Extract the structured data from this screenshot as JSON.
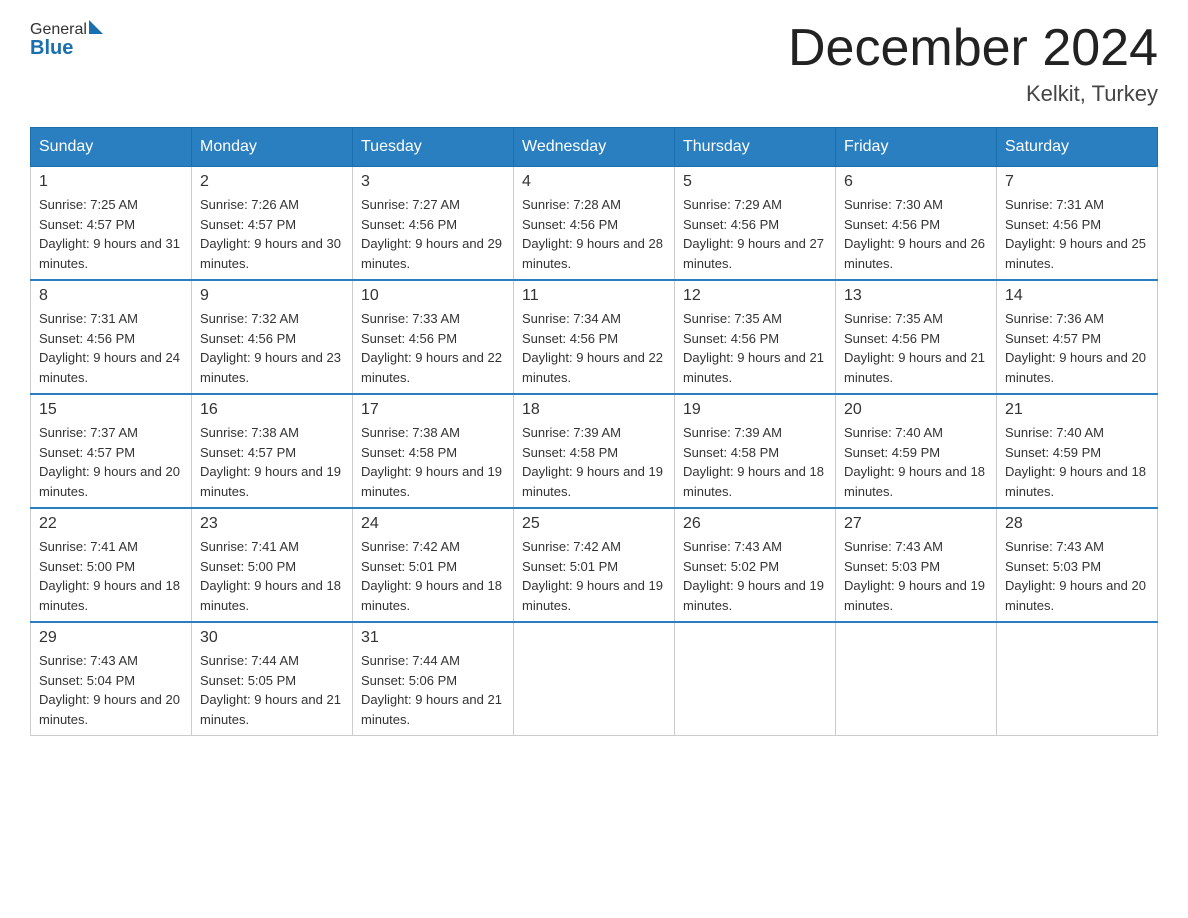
{
  "logo": {
    "general": "General",
    "blue": "Blue"
  },
  "title": "December 2024",
  "location": "Kelkit, Turkey",
  "days_of_week": [
    "Sunday",
    "Monday",
    "Tuesday",
    "Wednesday",
    "Thursday",
    "Friday",
    "Saturday"
  ],
  "weeks": [
    [
      {
        "num": "1",
        "sunrise": "7:25 AM",
        "sunset": "4:57 PM",
        "daylight": "9 hours and 31 minutes."
      },
      {
        "num": "2",
        "sunrise": "7:26 AM",
        "sunset": "4:57 PM",
        "daylight": "9 hours and 30 minutes."
      },
      {
        "num": "3",
        "sunrise": "7:27 AM",
        "sunset": "4:56 PM",
        "daylight": "9 hours and 29 minutes."
      },
      {
        "num": "4",
        "sunrise": "7:28 AM",
        "sunset": "4:56 PM",
        "daylight": "9 hours and 28 minutes."
      },
      {
        "num": "5",
        "sunrise": "7:29 AM",
        "sunset": "4:56 PM",
        "daylight": "9 hours and 27 minutes."
      },
      {
        "num": "6",
        "sunrise": "7:30 AM",
        "sunset": "4:56 PM",
        "daylight": "9 hours and 26 minutes."
      },
      {
        "num": "7",
        "sunrise": "7:31 AM",
        "sunset": "4:56 PM",
        "daylight": "9 hours and 25 minutes."
      }
    ],
    [
      {
        "num": "8",
        "sunrise": "7:31 AM",
        "sunset": "4:56 PM",
        "daylight": "9 hours and 24 minutes."
      },
      {
        "num": "9",
        "sunrise": "7:32 AM",
        "sunset": "4:56 PM",
        "daylight": "9 hours and 23 minutes."
      },
      {
        "num": "10",
        "sunrise": "7:33 AM",
        "sunset": "4:56 PM",
        "daylight": "9 hours and 22 minutes."
      },
      {
        "num": "11",
        "sunrise": "7:34 AM",
        "sunset": "4:56 PM",
        "daylight": "9 hours and 22 minutes."
      },
      {
        "num": "12",
        "sunrise": "7:35 AM",
        "sunset": "4:56 PM",
        "daylight": "9 hours and 21 minutes."
      },
      {
        "num": "13",
        "sunrise": "7:35 AM",
        "sunset": "4:56 PM",
        "daylight": "9 hours and 21 minutes."
      },
      {
        "num": "14",
        "sunrise": "7:36 AM",
        "sunset": "4:57 PM",
        "daylight": "9 hours and 20 minutes."
      }
    ],
    [
      {
        "num": "15",
        "sunrise": "7:37 AM",
        "sunset": "4:57 PM",
        "daylight": "9 hours and 20 minutes."
      },
      {
        "num": "16",
        "sunrise": "7:38 AM",
        "sunset": "4:57 PM",
        "daylight": "9 hours and 19 minutes."
      },
      {
        "num": "17",
        "sunrise": "7:38 AM",
        "sunset": "4:58 PM",
        "daylight": "9 hours and 19 minutes."
      },
      {
        "num": "18",
        "sunrise": "7:39 AM",
        "sunset": "4:58 PM",
        "daylight": "9 hours and 19 minutes."
      },
      {
        "num": "19",
        "sunrise": "7:39 AM",
        "sunset": "4:58 PM",
        "daylight": "9 hours and 18 minutes."
      },
      {
        "num": "20",
        "sunrise": "7:40 AM",
        "sunset": "4:59 PM",
        "daylight": "9 hours and 18 minutes."
      },
      {
        "num": "21",
        "sunrise": "7:40 AM",
        "sunset": "4:59 PM",
        "daylight": "9 hours and 18 minutes."
      }
    ],
    [
      {
        "num": "22",
        "sunrise": "7:41 AM",
        "sunset": "5:00 PM",
        "daylight": "9 hours and 18 minutes."
      },
      {
        "num": "23",
        "sunrise": "7:41 AM",
        "sunset": "5:00 PM",
        "daylight": "9 hours and 18 minutes."
      },
      {
        "num": "24",
        "sunrise": "7:42 AM",
        "sunset": "5:01 PM",
        "daylight": "9 hours and 18 minutes."
      },
      {
        "num": "25",
        "sunrise": "7:42 AM",
        "sunset": "5:01 PM",
        "daylight": "9 hours and 19 minutes."
      },
      {
        "num": "26",
        "sunrise": "7:43 AM",
        "sunset": "5:02 PM",
        "daylight": "9 hours and 19 minutes."
      },
      {
        "num": "27",
        "sunrise": "7:43 AM",
        "sunset": "5:03 PM",
        "daylight": "9 hours and 19 minutes."
      },
      {
        "num": "28",
        "sunrise": "7:43 AM",
        "sunset": "5:03 PM",
        "daylight": "9 hours and 20 minutes."
      }
    ],
    [
      {
        "num": "29",
        "sunrise": "7:43 AM",
        "sunset": "5:04 PM",
        "daylight": "9 hours and 20 minutes."
      },
      {
        "num": "30",
        "sunrise": "7:44 AM",
        "sunset": "5:05 PM",
        "daylight": "9 hours and 21 minutes."
      },
      {
        "num": "31",
        "sunrise": "7:44 AM",
        "sunset": "5:06 PM",
        "daylight": "9 hours and 21 minutes."
      },
      null,
      null,
      null,
      null
    ]
  ]
}
